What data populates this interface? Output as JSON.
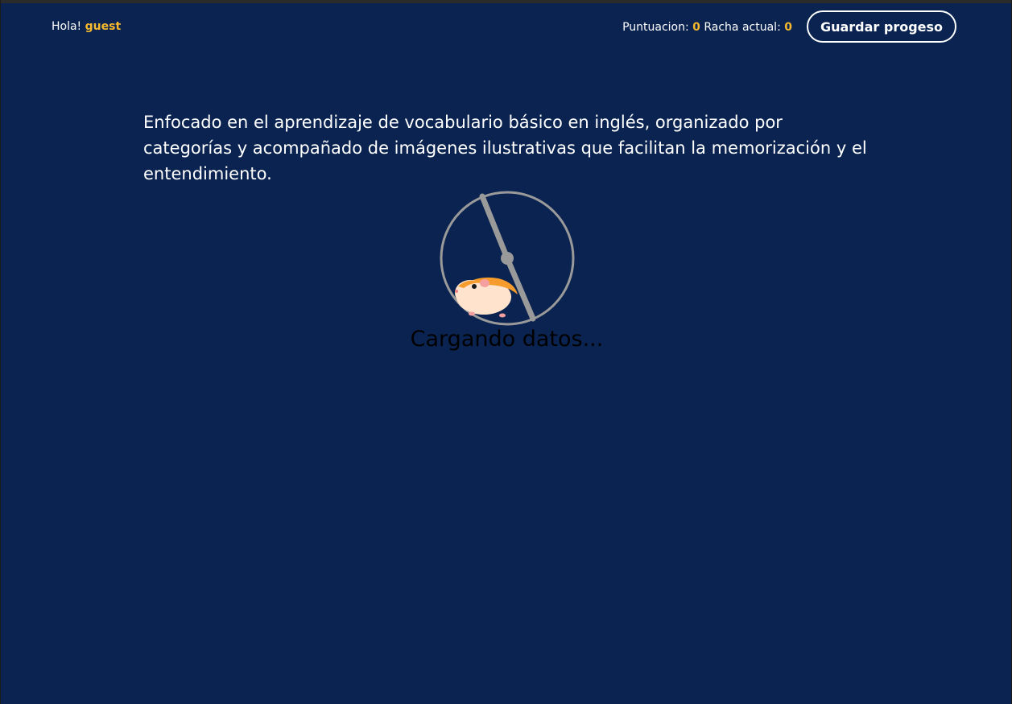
{
  "header": {
    "greeting_prefix": "Hola!",
    "username": "guest",
    "score_label": "Puntuacion:",
    "score_value": "0",
    "streak_label": "Racha actual:",
    "streak_value": "0",
    "save_button": "Guardar progeso"
  },
  "main": {
    "description": "Enfocado en el aprendizaje de vocabulario básico en inglés, organizado por categorías y acompañado de imágenes ilustrativas que facilitan la memorización y el entendimiento.",
    "loading_text": "Cargando datos...",
    "loader_icon": "hamster-wheel-icon"
  },
  "colors": {
    "background": "#0a2350",
    "accent": "#f5b82e",
    "text": "#ffffff"
  }
}
